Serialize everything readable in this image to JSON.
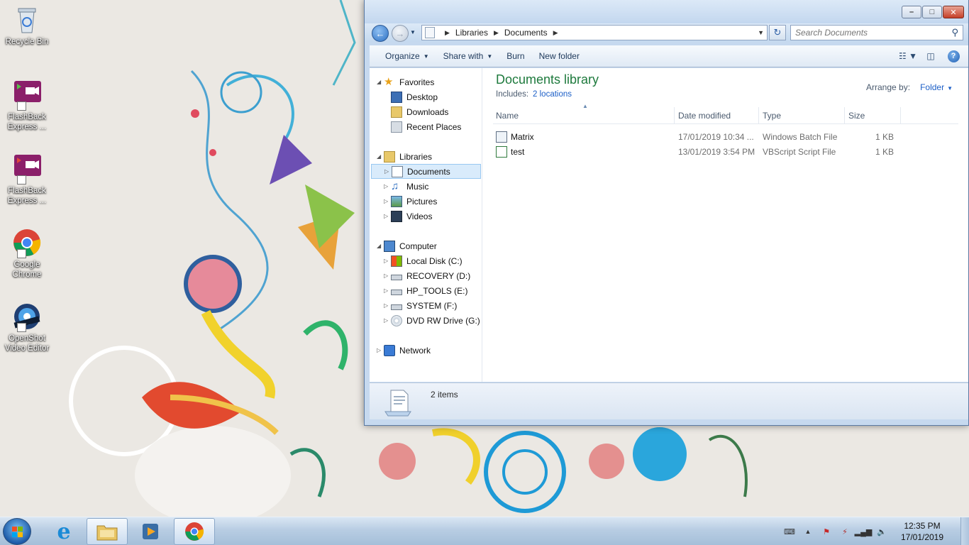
{
  "desktop": {
    "icons": [
      {
        "label": "Recycle Bin",
        "icon": "recycle-bin-icon"
      },
      {
        "label": "FlashBack Express ...",
        "icon": "flashback-express-icon"
      },
      {
        "label": "FlashBack Express ...",
        "icon": "flashback-express-icon"
      },
      {
        "label": "Google Chrome",
        "icon": "chrome-icon"
      },
      {
        "label": "OpenShot Video Editor",
        "icon": "openshot-icon"
      }
    ]
  },
  "explorer": {
    "address": {
      "crumbs": [
        "Libraries",
        "Documents"
      ]
    },
    "search": {
      "placeholder": "Search Documents"
    },
    "toolbar": {
      "organize": "Organize",
      "share_with": "Share with",
      "burn": "Burn",
      "new_folder": "New folder"
    },
    "nav": {
      "favorites": {
        "label": "Favorites",
        "items": [
          "Desktop",
          "Downloads",
          "Recent Places"
        ]
      },
      "libraries": {
        "label": "Libraries",
        "items": [
          "Documents",
          "Music",
          "Pictures",
          "Videos"
        ]
      },
      "computer": {
        "label": "Computer",
        "items": [
          "Local Disk (C:)",
          "RECOVERY (D:)",
          "HP_TOOLS (E:)",
          "SYSTEM (F:)",
          "DVD RW Drive (G:) G"
        ]
      },
      "network": {
        "label": "Network"
      }
    },
    "library": {
      "title": "Documents library",
      "includes_label": "Includes:",
      "includes_link": "2 locations",
      "arrange_by_label": "Arrange by:",
      "arrange_by_value": "Folder"
    },
    "columns": {
      "name": "Name",
      "date_modified": "Date modified",
      "type": "Type",
      "size": "Size"
    },
    "files": [
      {
        "name": "Matrix",
        "date": "17/01/2019 10:34 ...",
        "type": "Windows Batch File",
        "size": "1 KB"
      },
      {
        "name": "test",
        "date": "13/01/2019 3:54 PM",
        "type": "VBScript Script File",
        "size": "1 KB"
      }
    ],
    "status": {
      "count": "2 items"
    }
  },
  "taskbar": {
    "apps": [
      "internet-explorer-icon",
      "windows-explorer-icon",
      "media-player-icon",
      "chrome-icon"
    ],
    "clock": {
      "time": "12:35 PM",
      "date": "17/01/2019"
    }
  },
  "colors": {
    "library_title": "#1e7a3d",
    "link_blue": "#1c5fc7",
    "selection": "#d9ebfb"
  }
}
